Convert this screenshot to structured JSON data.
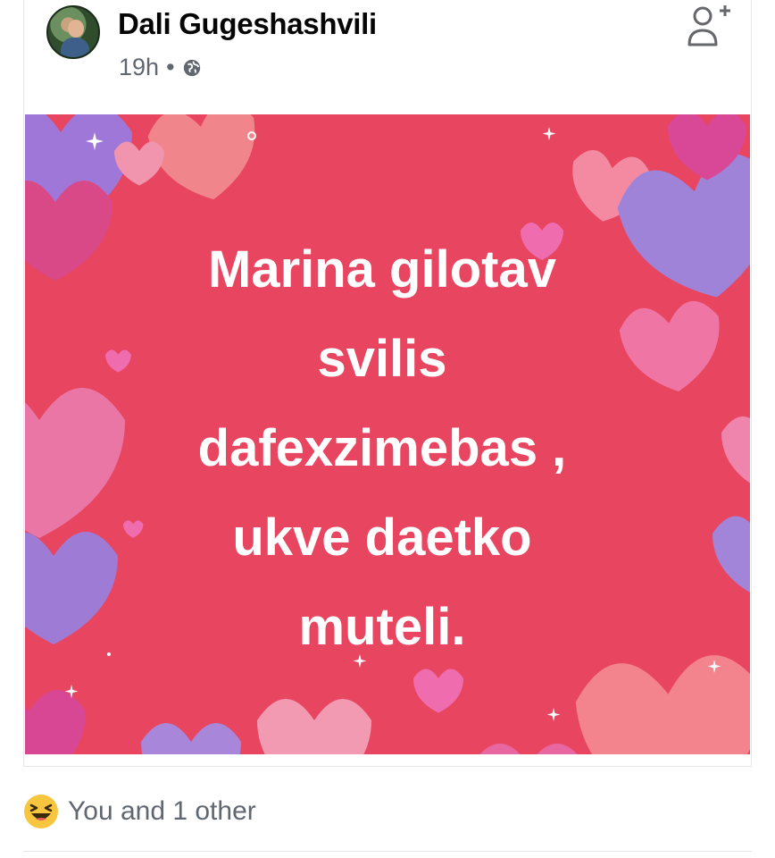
{
  "post": {
    "author": "Dali Gugeshashvili",
    "time": "19h",
    "separator": "•",
    "privacy_icon": "globe-icon",
    "action_icon": "add-friend-icon",
    "image_text": [
      "Marina gilotav",
      "svilis",
      "dafexzimebas ,",
      "ukve daetko",
      "muteli."
    ],
    "image_bg_color": "#e84560"
  },
  "reactions": {
    "icon": "haha-reaction-icon",
    "text": "You and 1 other"
  }
}
